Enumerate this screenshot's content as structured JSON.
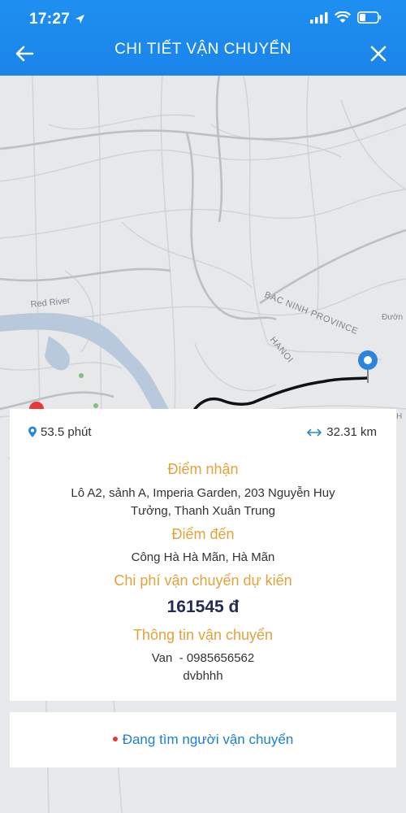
{
  "status_bar": {
    "time": "17:27"
  },
  "header": {
    "title": "CHI TIẾT VẬN CHUYỂN"
  },
  "map": {
    "labels": {
      "river": "Red River",
      "province": "BAC NINH PROVINCE",
      "city": "HANOI",
      "road": "Đườn",
      "edge": "H"
    }
  },
  "trip": {
    "duration": "53.5 phút",
    "distance": "32.31 km",
    "pickup_label": "Điểm nhận",
    "pickup_address_line1": "Lô A2, sảnh A, Imperia Garden, 203 Nguyễn Huy",
    "pickup_address_line2": "Tưởng, Thanh Xuân Trung",
    "dropoff_label": "Điểm đến",
    "dropoff_address": "Công Hà Hà Mãn, Hà Mãn",
    "cost_label": "Chi phí vận chuyển dự kiến",
    "cost_value": "161545 đ",
    "info_label": "Thông tin vận chuyển",
    "vehicle_line": "Van  - 0985656562",
    "note": "dvbhhh"
  },
  "status": {
    "text": "Đang tìm người vận chuyển"
  },
  "colors": {
    "header_bg": "#1e8ff0",
    "section_title": "#e3a23a",
    "price": "#222b50",
    "status_text": "#1d7ed6",
    "status_dot": "#e53935",
    "map_pin": "#2b86d9"
  }
}
